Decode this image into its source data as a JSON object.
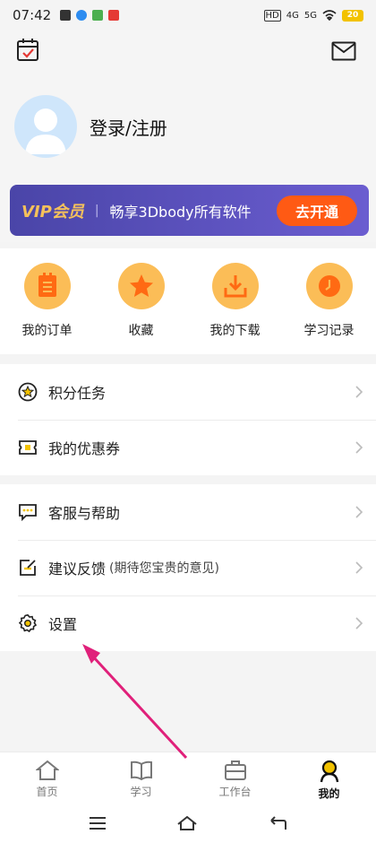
{
  "status": {
    "time": "07:42",
    "network_hd": "HD",
    "network_4g": "4G",
    "network_5g": "5G",
    "battery": "20"
  },
  "header": {
    "calendar_icon": "calendar-check-icon",
    "mail_icon": "mail-icon",
    "login_text": "登录/注册"
  },
  "vip": {
    "title": "VIP会员",
    "separator": "|",
    "desc": "畅享3Dbody所有软件",
    "button": "去开通"
  },
  "quick": [
    {
      "label": "我的订单",
      "icon": "order-list-icon"
    },
    {
      "label": "收藏",
      "icon": "star-icon"
    },
    {
      "label": "我的下载",
      "icon": "download-icon"
    },
    {
      "label": "学习记录",
      "icon": "clock-icon"
    }
  ],
  "menu1": [
    {
      "label": "积分任务",
      "icon": "points-star-icon"
    },
    {
      "label": "我的优惠券",
      "icon": "coupon-icon"
    }
  ],
  "menu2": [
    {
      "label": "客服与帮助",
      "icon": "chat-icon"
    },
    {
      "label": "建议反馈",
      "sub": "(期待您宝贵的意见)",
      "icon": "feedback-edit-icon"
    },
    {
      "label": "设置",
      "icon": "settings-gear-icon"
    }
  ],
  "tabs": [
    {
      "label": "首页",
      "icon": "home-icon"
    },
    {
      "label": "学习",
      "icon": "book-icon"
    },
    {
      "label": "工作台",
      "icon": "briefcase-icon"
    },
    {
      "label": "我的",
      "icon": "profile-icon",
      "active": true
    }
  ],
  "colors": {
    "accent": "#fbbd57",
    "vip_bg": "#5a52bd",
    "vip_button": "#ff5a14",
    "annotation_arrow": "#e0207a"
  }
}
